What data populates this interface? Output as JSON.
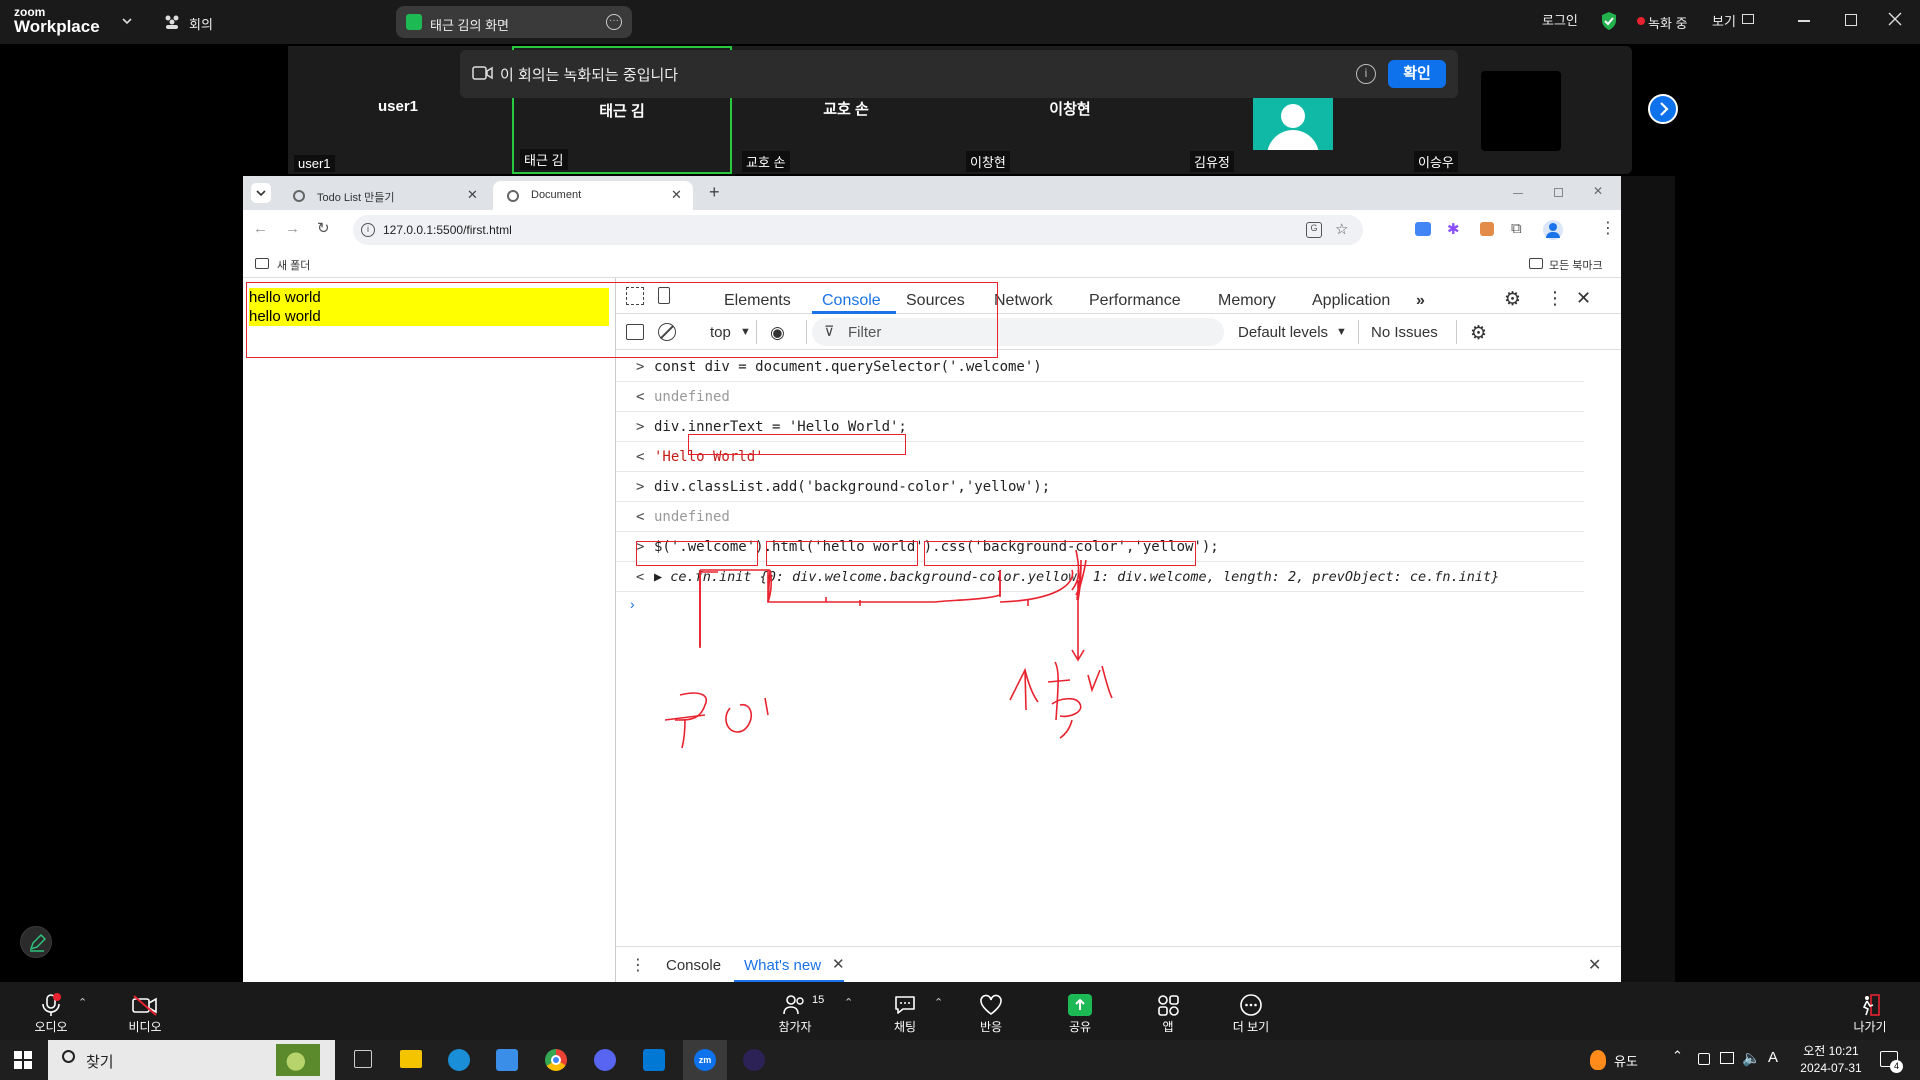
{
  "zoom": {
    "logo_small": "zoom",
    "logo_big": "Workplace",
    "meeting_label": "회의",
    "share_title": "태근 김의 화면",
    "login": "로그인",
    "recording": "녹화 중",
    "view": "보기",
    "banner_text": "이 회의는 녹화되는 중입니다",
    "banner_ok": "확인",
    "participants": [
      {
        "name": "user1",
        "label": "user1"
      },
      {
        "name": "태근 김",
        "label": "태근 김"
      },
      {
        "name": "교호 손",
        "label": "교호 손"
      },
      {
        "name": "이창현",
        "label": "이창현"
      },
      {
        "name": "",
        "label": "김유정"
      },
      {
        "name": "",
        "label": "이승우"
      }
    ],
    "toolbar": {
      "audio": "오디오",
      "video": "비디오",
      "participants": "참가자",
      "participants_count": "15",
      "chat": "채팅",
      "reactions": "반응",
      "share": "공유",
      "apps": "앱",
      "more": "더 보기",
      "leave": "나가기"
    }
  },
  "browser": {
    "tabs": [
      {
        "title": "Todo List 만들기"
      },
      {
        "title": "Document"
      }
    ],
    "url": "127.0.0.1:5500/first.html",
    "bookmark_left": "새 폴더",
    "bookmark_right": "모든 북마크"
  },
  "page": {
    "lines": [
      "hello world",
      "hello world"
    ]
  },
  "devtools": {
    "tabs": [
      "Elements",
      "Console",
      "Sources",
      "Network",
      "Performance",
      "Memory",
      "Application"
    ],
    "active_tab": "Console",
    "context": "top",
    "filter_placeholder": "Filter",
    "levels": "Default levels",
    "issues": "No Issues",
    "drawer_tabs": [
      "Console",
      "What's new"
    ],
    "console": [
      {
        "dir": ">",
        "text": "const div = document.querySelector('.welcome')"
      },
      {
        "dir": "<",
        "text": "undefined"
      },
      {
        "dir": ">",
        "text": "div.innerText = 'Hello World';"
      },
      {
        "dir": "<",
        "text": "'Hello World'"
      },
      {
        "dir": ">",
        "text": "div.classList.add('background-color','yellow');"
      },
      {
        "dir": "<",
        "text": "undefined"
      },
      {
        "dir": ">",
        "text": "$('.welcome').html('hello world').css('background-color','yellow');"
      },
      {
        "dir": "<",
        "text": "▶ ce.fn.init {0: div.welcome.background-color.yellow, 1: div.welcome, length: 2, prevObject: ce.fn.init}"
      }
    ]
  },
  "taskbar": {
    "search": "찾기",
    "weather": "유도",
    "time": "오전 10:21",
    "date": "2024-07-31",
    "ime": "A",
    "notify_count": "4"
  },
  "colors": {
    "annotation": "#e8232f",
    "highlight": "#ffff00",
    "zoom_blue": "#0e72ed",
    "devtools_active": "#1a73e8"
  }
}
